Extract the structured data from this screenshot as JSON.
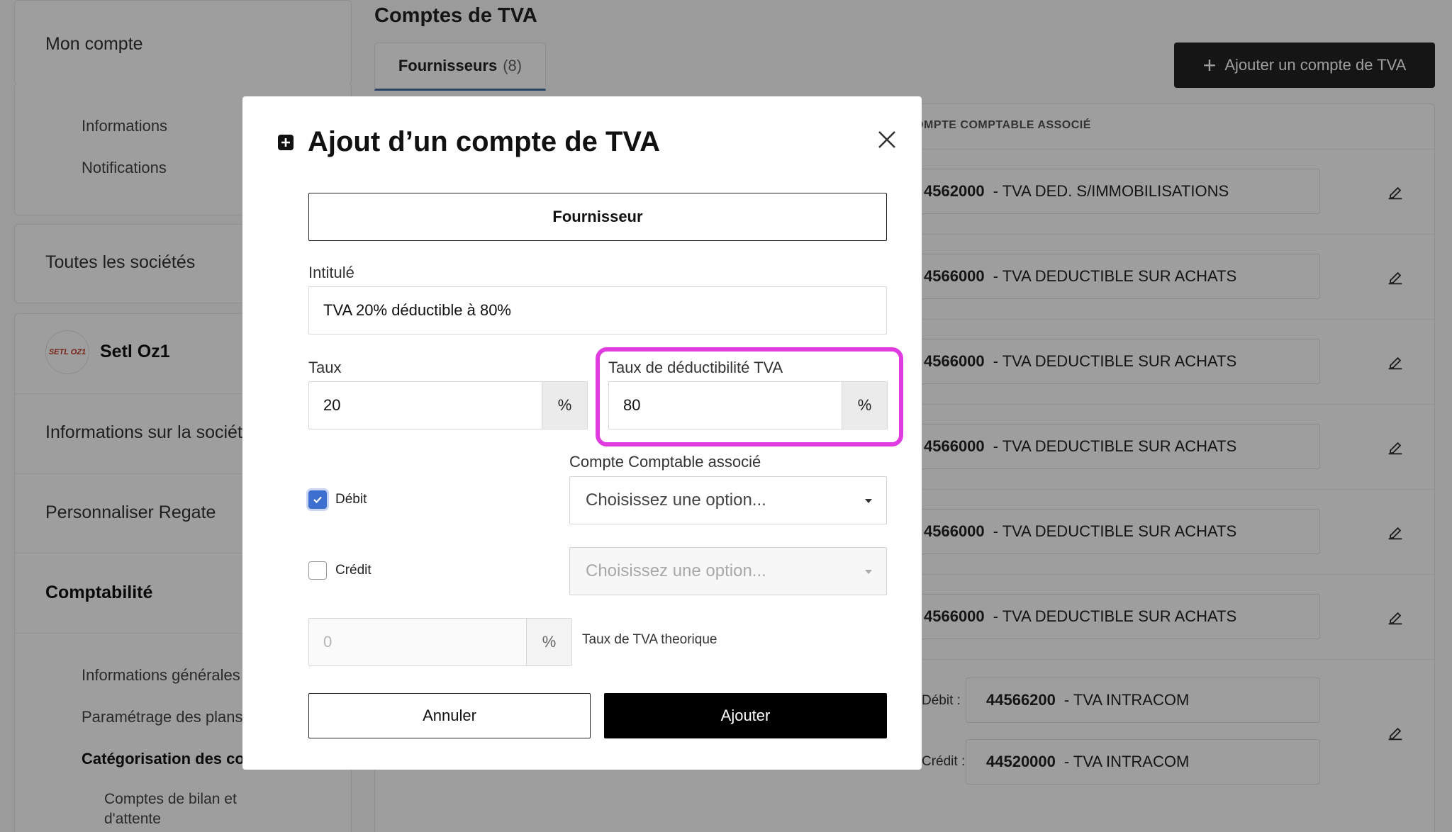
{
  "sidebar": {
    "account_title": "Mon compte",
    "account_items": [
      "Informations",
      "Notifications"
    ],
    "all_companies": "Toutes les sociétés",
    "company_logo_text": "SETL OZ1",
    "company_name": "Setl Oz1",
    "company_info": "Informations sur la société",
    "customize": "Personnaliser Regate",
    "accounting_title": "Comptabilité",
    "accounting_items": [
      "Informations générales",
      "Paramétrage des plans",
      "Catégorisation des comptes"
    ],
    "accounting_subitem": "Comptes de bilan et d'attente"
  },
  "page": {
    "title": "Comptes de TVA",
    "tab_label": "Fournisseurs",
    "tab_count": "(8)",
    "add_button": "Ajouter un compte de TVA",
    "column_header": "COMPTE COMPTABLE ASSOCIÉ",
    "rows": [
      {
        "num": "4562000",
        "label": "- TVA DED. S/IMMOBILISATIONS"
      },
      {
        "num": "4566000",
        "label": "- TVA DEDUCTIBLE SUR ACHATS"
      },
      {
        "num": "4566000",
        "label": "- TVA DEDUCTIBLE SUR ACHATS"
      },
      {
        "num": "4566000",
        "label": "- TVA DEDUCTIBLE SUR ACHATS"
      },
      {
        "num": "4566000",
        "label": "- TVA DEDUCTIBLE SUR ACHATS"
      },
      {
        "num": "4566000",
        "label": "- TVA DEDUCTIBLE SUR ACHATS"
      }
    ],
    "double_row": {
      "debit_label": "Débit :",
      "credit_label": "Crédit :",
      "debit": {
        "num": "44566200",
        "label": "- TVA INTRACOM"
      },
      "credit": {
        "num": "44520000",
        "label": "- TVA INTRACOM"
      }
    }
  },
  "modal": {
    "title": "Ajout d’un compte de TVA",
    "type_button": "Fournisseur",
    "intitule_label": "Intitulé",
    "intitule_value": "TVA 20% déductible à 80%",
    "taux_label": "Taux",
    "taux_value": "20",
    "deduct_label": "Taux de déductibilité TVA",
    "deduct_value": "80",
    "percent": "%",
    "compte_label": "Compte Comptable associé",
    "debit_label": "Débit",
    "debit_checked": true,
    "credit_label": "Crédit",
    "credit_checked": false,
    "select_placeholder": "Choisissez une option...",
    "theo_value": "0",
    "theo_label": "Taux de TVA theorique",
    "cancel": "Annuler",
    "submit": "Ajouter"
  },
  "colors": {
    "highlight": "#e03be0",
    "checkbox_checked": "#3d6fd0",
    "primary_button": "#000000"
  }
}
